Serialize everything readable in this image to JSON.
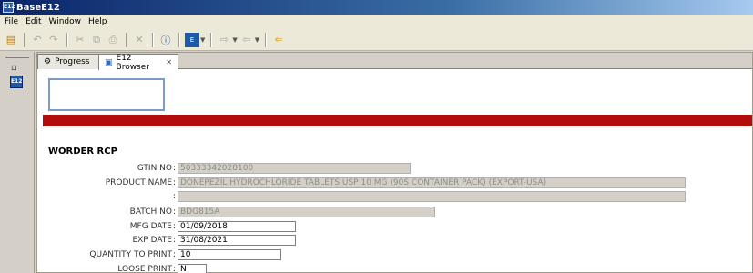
{
  "window": {
    "title": "BaseE12",
    "app_icon": "base-e12-app-icon"
  },
  "menu": [
    "File",
    "Edit",
    "Window",
    "Help"
  ],
  "toolbar": {
    "buttons": [
      "new-icon",
      "undo-icon",
      "redo-icon",
      "cut-icon",
      "copy-icon",
      "paste-icon",
      "delete-icon",
      "help-icon",
      "e12-icon",
      "forward-icon",
      "nav-icon",
      "back-arrow-icon"
    ]
  },
  "tabs": [
    {
      "label": "Progress",
      "icon": "progress-icon"
    },
    {
      "label": "E12 Browser",
      "icon": "browser-icon"
    }
  ],
  "form": {
    "title": "WORDER RCP",
    "fields": {
      "gtin": {
        "label": "GTIN NO",
        "value": "50333342028100"
      },
      "product": {
        "label": "PRODUCT NAME",
        "value": "DONEPEZIL HYDROCHLORIDE TABLETS USP 10 MG (90S CONTAINER PACK) (EXPORT-USA)"
      },
      "product2": {
        "label": "",
        "value": ""
      },
      "batch": {
        "label": "BATCH NO",
        "value": "BDG815A"
      },
      "mfg": {
        "label": "MFG DATE",
        "value": "01/09/2018"
      },
      "exp": {
        "label": "EXP DATE",
        "value": "31/08/2021"
      },
      "qty": {
        "label": "QUANTITY TO PRINT",
        "value": "10"
      },
      "loose": {
        "label": "LOOSE PRINT",
        "value": "N"
      }
    }
  },
  "colors": {
    "banner": "#b30c0c",
    "title_bar": "#0a246a"
  }
}
